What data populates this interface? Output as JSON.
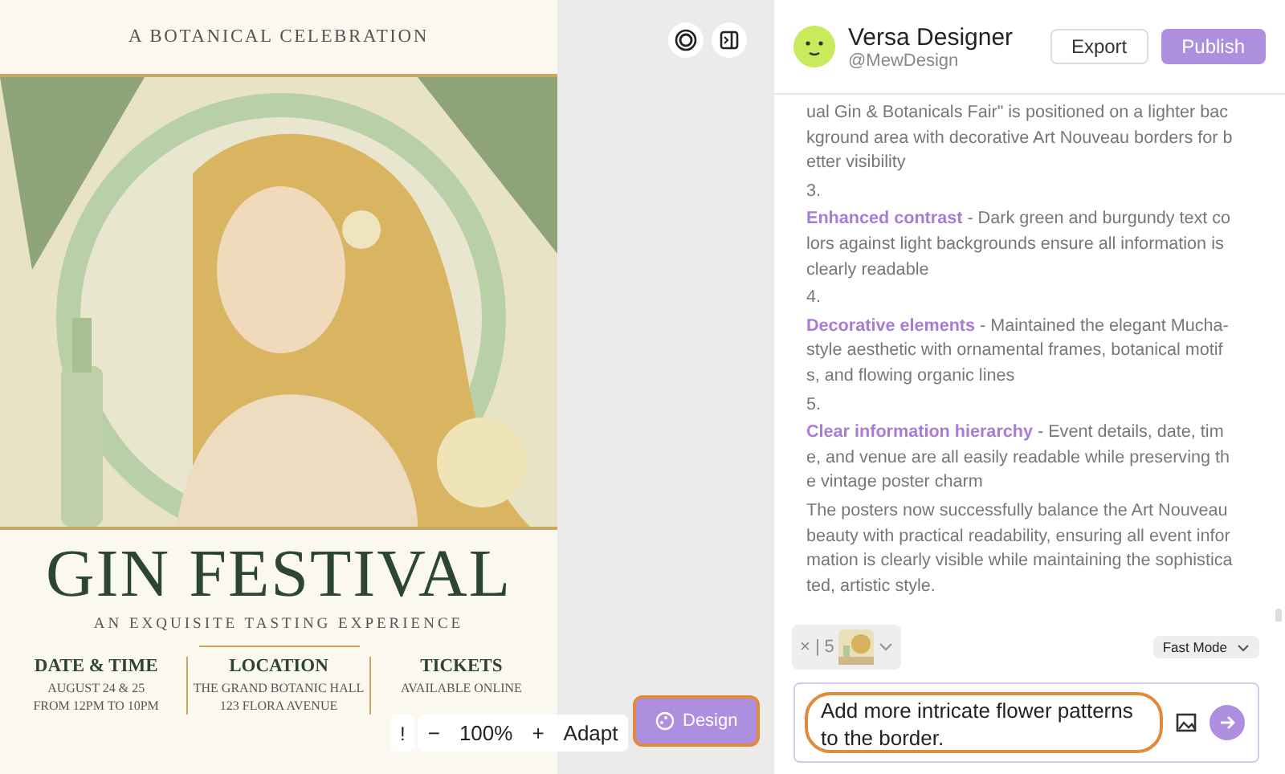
{
  "canvas": {
    "poster": {
      "tagline": "A BOTANICAL CELEBRATION",
      "title": "GIN FESTIVAL",
      "subtitle": "AN EXQUISITE TASTING EXPERIENCE",
      "details": [
        {
          "heading": "DATE & TIME",
          "lines": [
            "AUGUST 24 & 25",
            "FROM 12PM TO 10PM"
          ]
        },
        {
          "heading": "LOCATION",
          "lines": [
            "THE GRAND BOTANIC HALL",
            "123 FLORA AVENUE"
          ]
        },
        {
          "heading": "TICKETS",
          "lines": [
            "AVAILABLE ONLINE"
          ]
        }
      ]
    },
    "toolbar": {
      "alert": "!",
      "zoom_out": "−",
      "zoom": "100%",
      "zoom_in": "+",
      "fit": "Adapt"
    },
    "design_button": {
      "label": "Design",
      "highlighted": true
    }
  },
  "assistant": {
    "name": "Versa Designer",
    "handle": "@MewDesign",
    "buttons": [
      {
        "label": "Export",
        "kind": "secondary"
      },
      {
        "label": "Publish",
        "kind": "primary"
      }
    ]
  },
  "chat": {
    "lead": "ual Gin & Botanicals Fair\" is positioned on a lighter background area with decorative Art Nouveau borders for better visibility",
    "points": [
      {
        "number": "3.",
        "title": "Enhanced contrast",
        "text": " - Dark green and burgundy text colors against light backgrounds ensure all information is clearly readable"
      },
      {
        "number": "4.",
        "title": "Decorative elements",
        "text": " - Maintained the elegant Mucha-style aesthetic with ornamental frames, botanical motifs, and flowing organic lines"
      },
      {
        "number": "5.",
        "title": "Clear information hierarchy",
        "text": " - Event details, date, time, and venue are all easily readable while preserving the vintage poster charm"
      }
    ],
    "summary": "The posters now successfully balance the Art Nouveau beauty with practical readability, ensuring all event information is clearly visible while maintaining the sophisticated, artistic style."
  },
  "attachment": {
    "remove": "×",
    "separator": "|",
    "count": "5"
  },
  "mode": "Fast Mode",
  "prompt": {
    "value": "Add more intricate flower patterns to the border.",
    "highlighted": true
  }
}
